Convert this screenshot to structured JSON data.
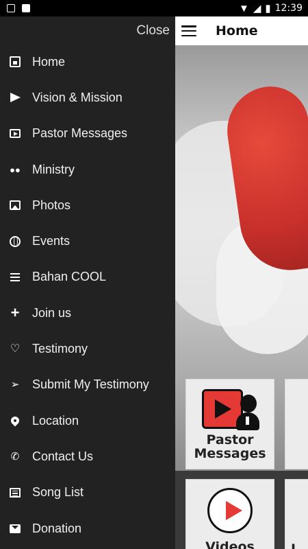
{
  "status_bar": {
    "time": "12:39",
    "left_icons": [
      "image-notification-icon",
      "app-notification-icon"
    ],
    "right_icons": [
      "wifi-icon",
      "signal-icon",
      "battery-icon"
    ]
  },
  "drawer": {
    "close_label": "Close",
    "items": [
      {
        "label": "Home",
        "icon": "calendar-icon"
      },
      {
        "label": "Vision & Mission",
        "icon": "send-icon"
      },
      {
        "label": "Pastor Messages",
        "icon": "video-icon"
      },
      {
        "label": "Ministry",
        "icon": "people-icon"
      },
      {
        "label": "Photos",
        "icon": "photo-icon"
      },
      {
        "label": "Events",
        "icon": "globe-icon"
      },
      {
        "label": "Bahan COOL",
        "icon": "list-icon"
      },
      {
        "label": "Join us",
        "icon": "plus-icon"
      },
      {
        "label": "Testimony",
        "icon": "heart-icon"
      },
      {
        "label": "Submit My Testimony",
        "icon": "paper-plane-icon"
      },
      {
        "label": "Location",
        "icon": "location-pin-icon"
      },
      {
        "label": "Contact Us",
        "icon": "phone-icon"
      },
      {
        "label": "Song List",
        "icon": "document-icon"
      },
      {
        "label": "Donation",
        "icon": "mail-icon"
      }
    ]
  },
  "app": {
    "title": "Home",
    "tiles": [
      {
        "label": "Pastor Messages",
        "icon": "pastor-play-icon"
      },
      {
        "label": "Videos",
        "icon": "play-circle-icon"
      }
    ],
    "partial_tile_glyph": "L",
    "colors": {
      "accent_red": "#e53935",
      "drawer_bg": "#222222"
    }
  }
}
